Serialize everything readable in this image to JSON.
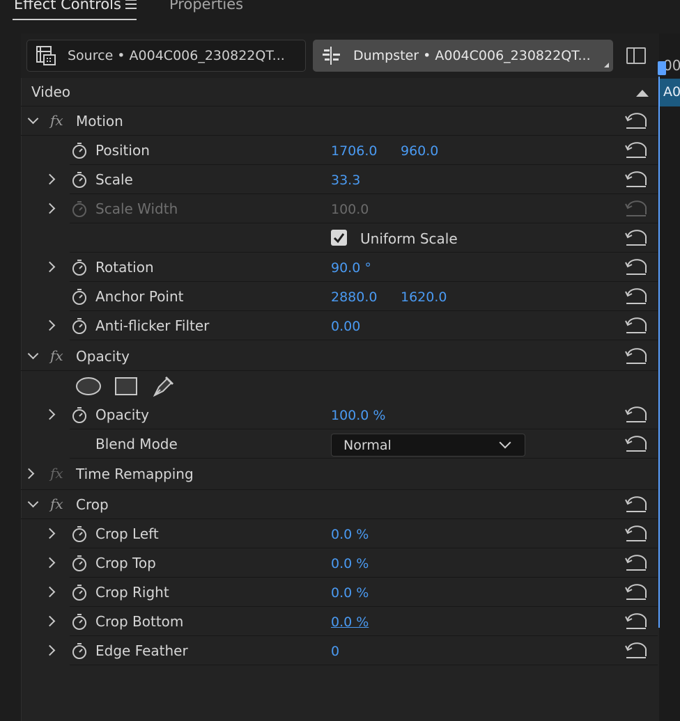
{
  "tabs": {
    "effect_controls": "Effect Controls",
    "properties": "Properties"
  },
  "source_bar": {
    "source_label": "Source • A004C006_230822QT...",
    "sequence_label": "Dumpster • A004C006_230822QT..."
  },
  "timeline": {
    "timecode_fragment": "00",
    "clip_fragment": "A0"
  },
  "section": {
    "video": "Video"
  },
  "motion": {
    "title": "Motion",
    "position": {
      "label": "Position",
      "x": "1706.0",
      "y": "960.0"
    },
    "scale": {
      "label": "Scale",
      "value": "33.3"
    },
    "scale_width": {
      "label": "Scale Width",
      "value": "100.0"
    },
    "uniform_scale": {
      "label": "Uniform Scale",
      "checked": true
    },
    "rotation": {
      "label": "Rotation",
      "value": "90.0 °"
    },
    "anchor_point": {
      "label": "Anchor Point",
      "x": "2880.0",
      "y": "1620.0"
    },
    "anti_flicker": {
      "label": "Anti-flicker Filter",
      "value": "0.00"
    }
  },
  "opacity": {
    "title": "Opacity",
    "opacity": {
      "label": "Opacity",
      "value": "100.0 %"
    },
    "blend_mode": {
      "label": "Blend Mode",
      "value": "Normal"
    }
  },
  "time_remapping": {
    "title": "Time Remapping"
  },
  "crop": {
    "title": "Crop",
    "left": {
      "label": "Crop Left",
      "value": "0.0 %"
    },
    "top": {
      "label": "Crop Top",
      "value": "0.0 %"
    },
    "right": {
      "label": "Crop Right",
      "value": "0.0 %"
    },
    "bottom": {
      "label": "Crop Bottom",
      "value": "0.0 %"
    },
    "edge_feather": {
      "label": "Edge Feather",
      "value": "0"
    }
  },
  "colors": {
    "value_blue": "#4a9af2",
    "playhead_blue": "#5aa0ff",
    "panel_bg": "#232323",
    "clip_blue": "#1c5a80"
  },
  "icons": [
    "hamburger-menu-icon",
    "film-strip-icon",
    "sequence-icon",
    "sidebar-toggle-icon",
    "collapse-up-icon",
    "stopwatch-icon",
    "reset-icon",
    "ellipse-mask-icon",
    "rectangle-mask-icon",
    "pen-mask-icon",
    "checkmark-icon"
  ]
}
